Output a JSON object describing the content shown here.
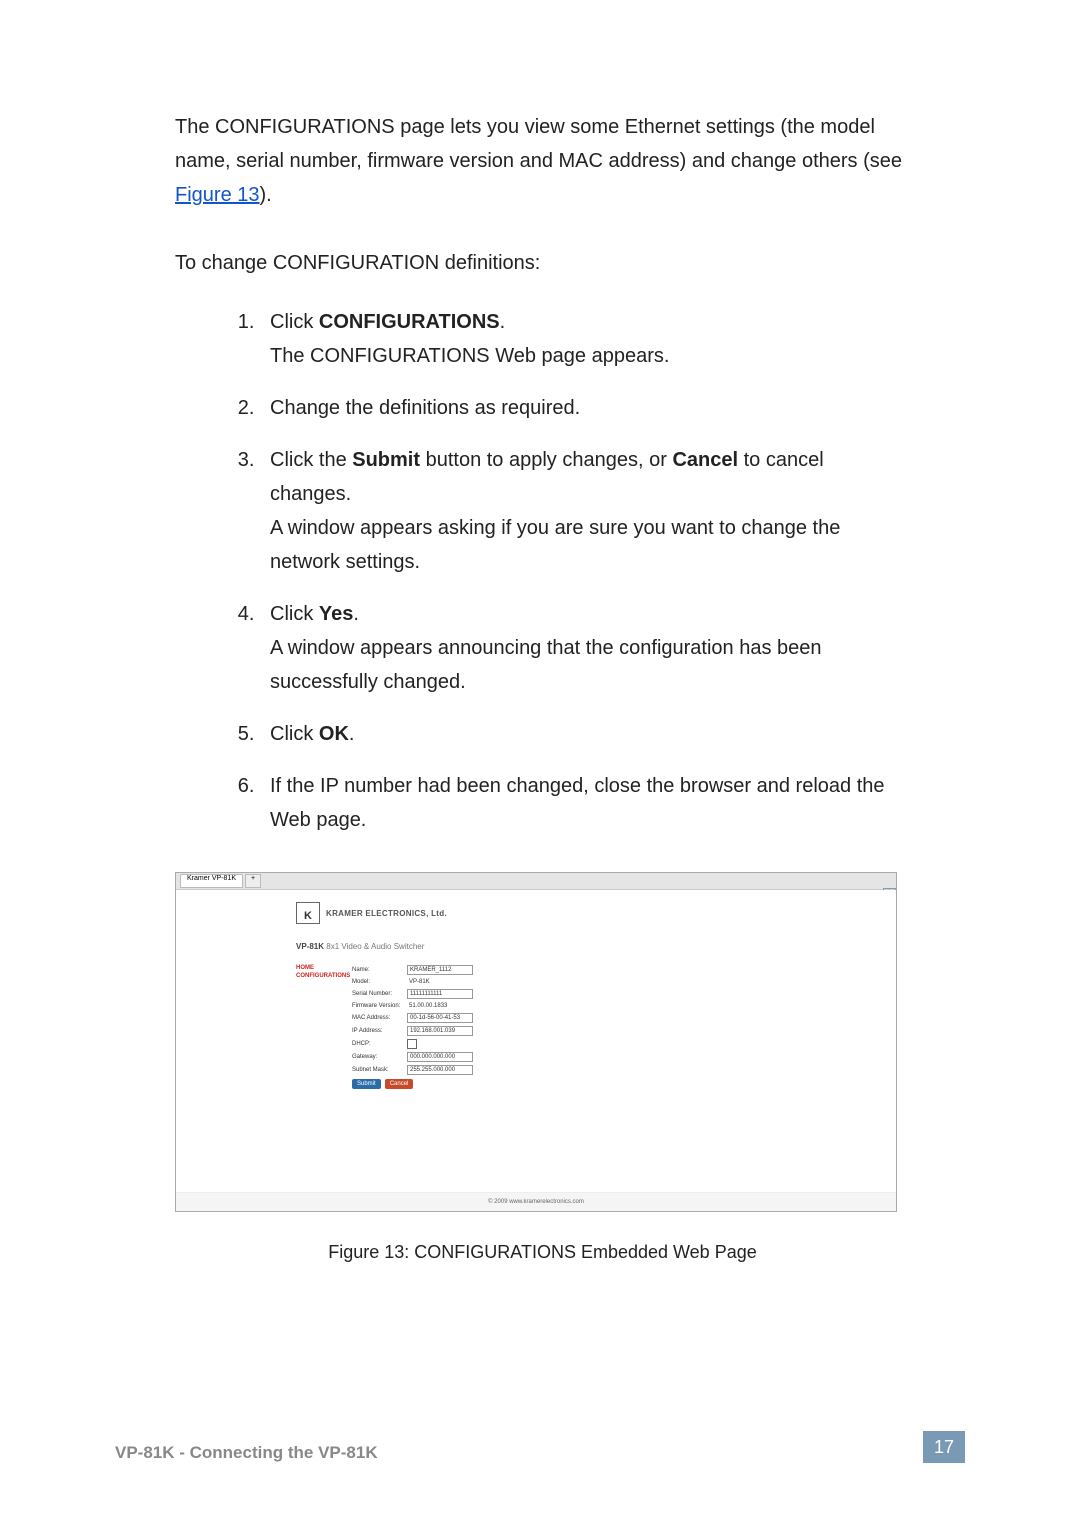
{
  "intro_p1": "The CONFIGURATIONS page lets you view some Ethernet settings (the model name, serial number, firmware version and MAC address) and change others (see ",
  "figure_link": "Figure 13",
  "intro_p2": ").",
  "subheading": "To change CONFIGURATION definitions:",
  "steps": [
    {
      "pre": "Click ",
      "bold": "CONFIGURATIONS",
      "post": ".\nThe CONFIGURATIONS Web page appears."
    },
    {
      "pre": "Change the definitions as required.",
      "bold": "",
      "post": ""
    },
    {
      "pre": "Click the ",
      "bold": "Submit",
      "post": " button to apply changes, or ",
      "bold2": "Cancel",
      "post2": " to cancel changes.\nA window appears asking if you are sure you want to change the network settings."
    },
    {
      "pre": "Click ",
      "bold": "Yes",
      "post": ".\nA window appears announcing that the configuration has been successfully changed."
    },
    {
      "pre": "Click ",
      "bold": "OK",
      "post": "."
    },
    {
      "pre": "If the IP number had been changed, close the browser and reload the Web page.",
      "bold": "",
      "post": ""
    }
  ],
  "browser": {
    "tab_label": "Kramer VP-81K",
    "tab_add": "+",
    "company": "KRAMER ELECTRONICS, Ltd.",
    "model_bold": "VP-81K",
    "model_rest": " 8x1 Video & Audio Switcher",
    "nav_home": "HOME",
    "nav_config": "CONFIGURATIONS",
    "form": {
      "name_label": "Name:",
      "name_value": "KRAMER_1112",
      "model_label": "Model:",
      "model_value": "VP-81K",
      "serial_label": "Serial Number:",
      "serial_value": "11111111111",
      "fw_label": "Firmware Version:",
      "fw_value": "51.00.00.1833",
      "mac_label": "MAC Address:",
      "mac_value": "00-1d-56-00-41-53",
      "ip_label": "IP Address:",
      "ip_value": "192.168.001.039",
      "dhcp_label": "DHCP:",
      "gw_label": "Gateway:",
      "gw_value": "000.000.000.000",
      "subnet_label": "Subnet Mask:",
      "subnet_value": "255.255.000.000",
      "submit": "Submit",
      "cancel": "Cancel"
    },
    "footer": "© 2009 www.kramerelectronics.com"
  },
  "caption": "Figure 13: CONFIGURATIONS Embedded Web Page",
  "footer_text": "VP-81K - Connecting the VP-81K",
  "page_number": "17"
}
